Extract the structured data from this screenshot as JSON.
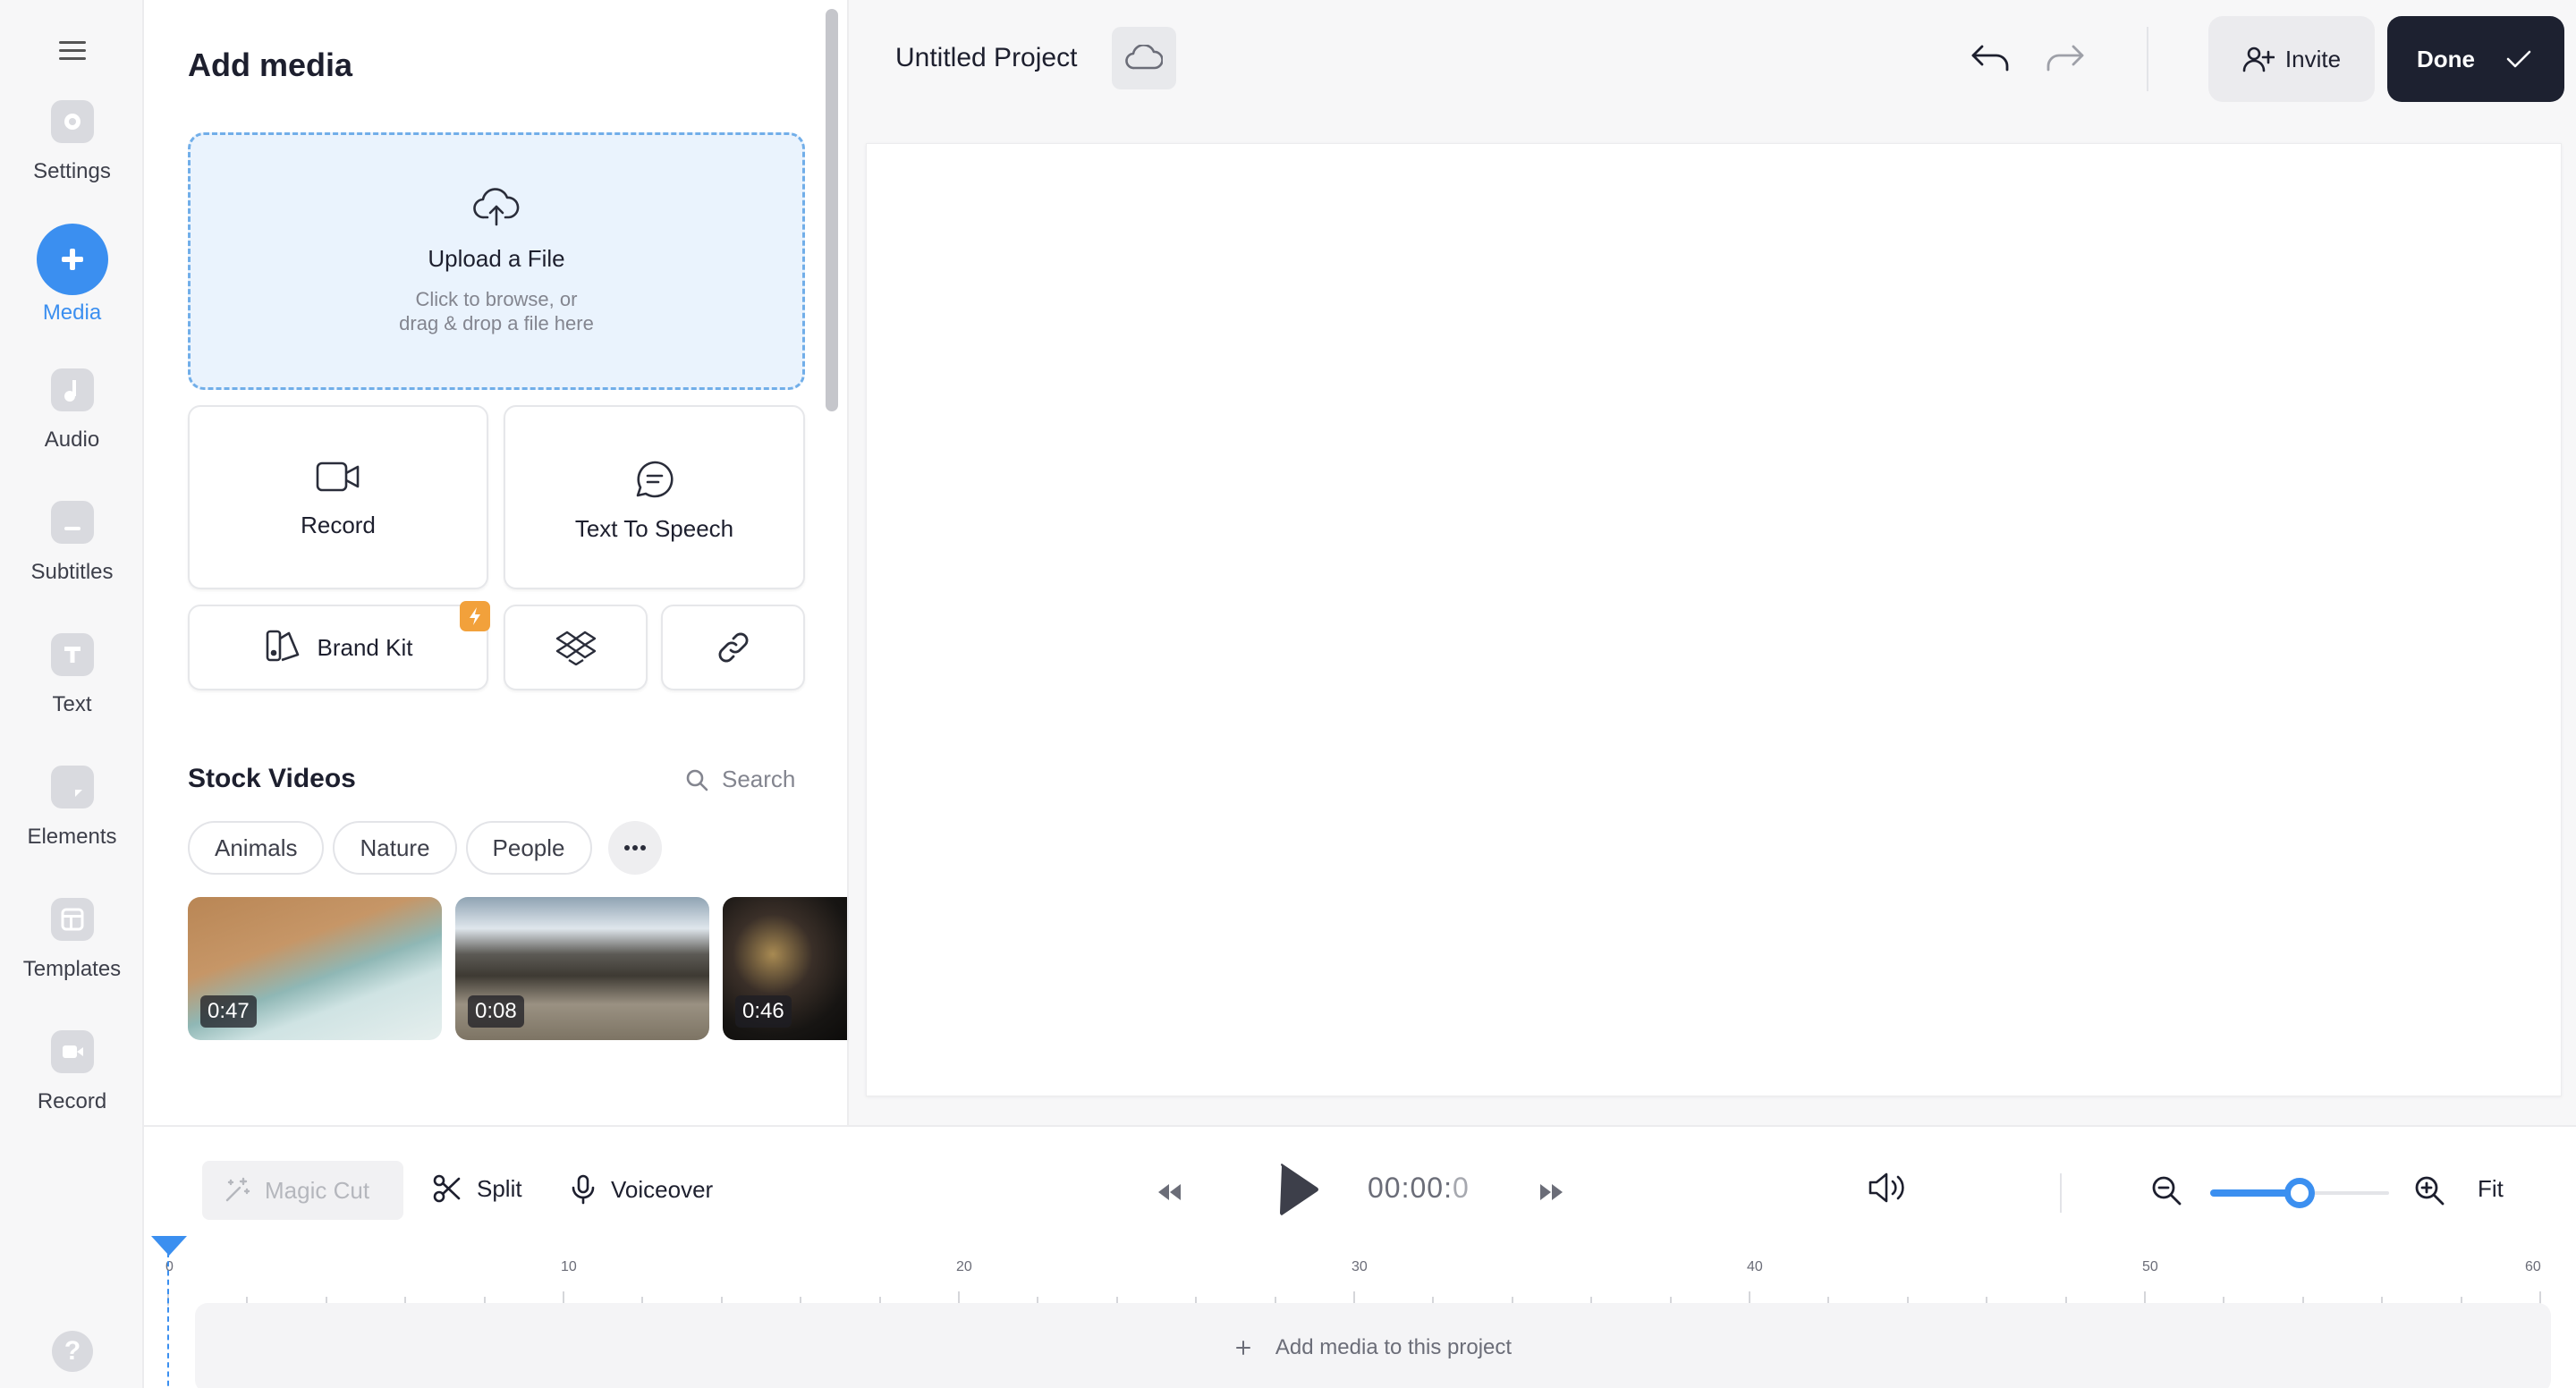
{
  "sidebar": {
    "items": [
      {
        "label": "Settings",
        "icon": "settings-icon"
      },
      {
        "label": "Media",
        "icon": "plus-icon",
        "active": true
      },
      {
        "label": "Audio",
        "icon": "music-note-icon"
      },
      {
        "label": "Subtitles",
        "icon": "subtitles-icon"
      },
      {
        "label": "Text",
        "icon": "text-icon"
      },
      {
        "label": "Elements",
        "icon": "sticky-note-icon"
      },
      {
        "label": "Templates",
        "icon": "layout-icon"
      },
      {
        "label": "Record",
        "icon": "video-camera-icon"
      }
    ],
    "help_glyph": "?"
  },
  "media_panel": {
    "title": "Add media",
    "upload": {
      "title": "Upload a File",
      "sub_line1": "Click to browse, or",
      "sub_line2": "drag & drop a file here"
    },
    "tiles": {
      "record": "Record",
      "tts": "Text To Speech",
      "brand_kit": "Brand Kit"
    },
    "stock": {
      "title": "Stock Videos",
      "search_placeholder": "Search",
      "chips": [
        "Animals",
        "Nature",
        "People"
      ],
      "thumbnails": [
        {
          "duration": "0:47",
          "subject": "beach waves"
        },
        {
          "duration": "0:08",
          "subject": "mountain valley"
        },
        {
          "duration": "0:46",
          "subject": "city at night"
        }
      ]
    }
  },
  "header": {
    "project_name": "Untitled Project",
    "invite_label": "Invite",
    "done_label": "Done"
  },
  "timeline": {
    "magic_cut_label": "Magic Cut",
    "split_label": "Split",
    "voiceover_label": "Voiceover",
    "timecode_main": "00:00:",
    "timecode_frac": "0",
    "zoom_level": 0.5,
    "fit_label": "Fit",
    "ruler_labels": [
      "0",
      "10",
      "20",
      "30",
      "40",
      "50",
      "60"
    ],
    "empty_track_text": "Add media to this project"
  },
  "colors": {
    "accent": "#3b8ff0",
    "done_button": "#1d2130",
    "brand_kit_badge": "#f2a13b",
    "upload_bg": "#eaf3fd"
  }
}
